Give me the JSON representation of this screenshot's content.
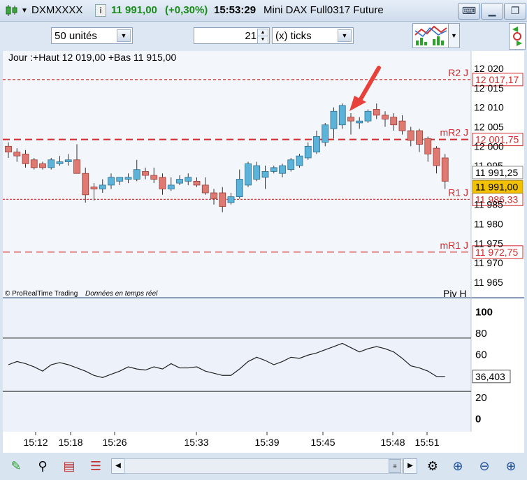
{
  "titlebar": {
    "symbol": "DXMXXXX",
    "price": "11 991,00",
    "change": "(+0,30%)",
    "time": "15:53:29",
    "name": "Mini DAX Full0317 Future"
  },
  "toolbar": {
    "units": "50 unités",
    "count": "21",
    "mode": "(x) ticks"
  },
  "price_chart": {
    "info": "Jour :+Haut 12 019,00 +Bas 11 915,00",
    "copyright": "© ProRealTime Trading",
    "realtime": "Données en temps réel",
    "piv_label": "Piv H",
    "ticks": [
      "12 020",
      "12 015",
      "12 010",
      "12 005",
      "12 000",
      "11 995",
      "11 990",
      "11 985",
      "11 980",
      "11 975",
      "11 970",
      "11 965"
    ],
    "levels": [
      {
        "name": "R2 J",
        "value": "12 017,17"
      },
      {
        "name": "mR2 J",
        "value": "12 001,75"
      },
      {
        "name": "R1 J",
        "value": "11 986,33"
      },
      {
        "name": "mR1 J",
        "value": "11 972,75"
      }
    ],
    "last_price": "11 991,00",
    "prev_price": "11 991,25"
  },
  "chart_data": {
    "type": "candlestick",
    "ylim": [
      11963,
      12022
    ],
    "candles": [
      {
        "o": 12000,
        "h": 12001,
        "l": 11997,
        "c": 11998.5
      },
      {
        "o": 11998.5,
        "h": 11999.5,
        "l": 11996,
        "c": 11997.5
      },
      {
        "o": 11998,
        "h": 11999,
        "l": 11994.5,
        "c": 11995.5
      },
      {
        "o": 11996.5,
        "h": 11997,
        "l": 11994,
        "c": 11994.5
      },
      {
        "o": 11995.5,
        "h": 11996,
        "l": 11994,
        "c": 11994.5
      },
      {
        "o": 11994.5,
        "h": 11997,
        "l": 11994,
        "c": 11996.5
      },
      {
        "o": 11995.5,
        "h": 11997.5,
        "l": 11995,
        "c": 11996
      },
      {
        "o": 11996,
        "h": 11998,
        "l": 11995,
        "c": 11996.5
      },
      {
        "o": 11996.5,
        "h": 12000.5,
        "l": 11994,
        "c": 11993
      },
      {
        "o": 11993,
        "h": 11994.5,
        "l": 11985.5,
        "c": 11987.5
      },
      {
        "o": 11989.5,
        "h": 11990.5,
        "l": 11986,
        "c": 11989
      },
      {
        "o": 11989,
        "h": 11991.5,
        "l": 11988,
        "c": 11990
      },
      {
        "o": 11990,
        "h": 11993,
        "l": 11989,
        "c": 11992
      },
      {
        "o": 11991,
        "h": 11992,
        "l": 11990,
        "c": 11992
      },
      {
        "o": 11991.5,
        "h": 11993,
        "l": 11990.5,
        "c": 11992
      },
      {
        "o": 11991.5,
        "h": 11996.5,
        "l": 11991,
        "c": 11994
      },
      {
        "o": 11993.5,
        "h": 11994.5,
        "l": 11991.5,
        "c": 11992.5
      },
      {
        "o": 11992.5,
        "h": 11994.5,
        "l": 11990.5,
        "c": 11991.5
      },
      {
        "o": 11992,
        "h": 11993,
        "l": 11987.5,
        "c": 11989
      },
      {
        "o": 11989,
        "h": 11992,
        "l": 11988.5,
        "c": 11990
      },
      {
        "o": 11990.5,
        "h": 11992.5,
        "l": 11990,
        "c": 11991.5
      },
      {
        "o": 11991,
        "h": 11993,
        "l": 11990,
        "c": 11992
      },
      {
        "o": 11991,
        "h": 11992,
        "l": 11989.5,
        "c": 11990
      },
      {
        "o": 11990,
        "h": 11992,
        "l": 11987.5,
        "c": 11988
      },
      {
        "o": 11988,
        "h": 11989,
        "l": 11985,
        "c": 11986.5
      },
      {
        "o": 11988,
        "h": 11989.5,
        "l": 11983,
        "c": 11984.5
      },
      {
        "o": 11985.5,
        "h": 11988,
        "l": 11985,
        "c": 11987
      },
      {
        "o": 11987,
        "h": 11994,
        "l": 11986.5,
        "c": 11991.5
      },
      {
        "o": 11990,
        "h": 11996,
        "l": 11989.5,
        "c": 11995.5
      },
      {
        "o": 11991.5,
        "h": 11996,
        "l": 11991,
        "c": 11995
      },
      {
        "o": 11992,
        "h": 11995,
        "l": 11989,
        "c": 11993.5
      },
      {
        "o": 11993.5,
        "h": 11995,
        "l": 11993,
        "c": 11994.5
      },
      {
        "o": 11993,
        "h": 11995.5,
        "l": 11992,
        "c": 11995
      },
      {
        "o": 11994,
        "h": 11997,
        "l": 11993.5,
        "c": 11996.5
      },
      {
        "o": 11995,
        "h": 11998,
        "l": 11994.5,
        "c": 11997.5
      },
      {
        "o": 11997,
        "h": 12001,
        "l": 11996.5,
        "c": 12000
      },
      {
        "o": 11998.5,
        "h": 12004,
        "l": 11998,
        "c": 12002.5
      },
      {
        "o": 12001,
        "h": 12006,
        "l": 12000,
        "c": 12005.5
      },
      {
        "o": 12004.5,
        "h": 12010,
        "l": 12002,
        "c": 12009
      },
      {
        "o": 12005.5,
        "h": 12011,
        "l": 12004.5,
        "c": 12010.5
      },
      {
        "o": 12007.5,
        "h": 12008.5,
        "l": 12003,
        "c": 12006.5
      },
      {
        "o": 12006,
        "h": 12007.5,
        "l": 12004.5,
        "c": 12006.5
      },
      {
        "o": 12006.5,
        "h": 12009.5,
        "l": 12006,
        "c": 12009
      },
      {
        "o": 12009.5,
        "h": 12011,
        "l": 12007,
        "c": 12008
      },
      {
        "o": 12008,
        "h": 12009,
        "l": 12005,
        "c": 12007
      },
      {
        "o": 12007.5,
        "h": 12008.5,
        "l": 12004,
        "c": 12005.5
      },
      {
        "o": 12006.5,
        "h": 12008,
        "l": 12003,
        "c": 12004
      },
      {
        "o": 12004,
        "h": 12005,
        "l": 12000,
        "c": 12001.5
      },
      {
        "o": 12004,
        "h": 12004.5,
        "l": 11998.5,
        "c": 12000.5
      },
      {
        "o": 12002,
        "h": 12002.5,
        "l": 11996,
        "c": 11998
      },
      {
        "o": 11999.5,
        "h": 12000,
        "l": 11993,
        "c": 11995
      },
      {
        "o": 11997,
        "h": 11998,
        "l": 11989,
        "c": 11991
      }
    ],
    "indicator": {
      "ylim": [
        -5,
        105
      ],
      "ticks": [
        0,
        20,
        40,
        60,
        80,
        100
      ],
      "hlines": [
        75,
        25
      ],
      "last": "36,403",
      "values": [
        50,
        53,
        51,
        48,
        44,
        50,
        52,
        50,
        47,
        44,
        40,
        38,
        41,
        44,
        48,
        46,
        45,
        48,
        46,
        51,
        47,
        47,
        48,
        44,
        42,
        40,
        40,
        46,
        53,
        57,
        54,
        50,
        53,
        57,
        56,
        59,
        61,
        64,
        67,
        70,
        66,
        62,
        65,
        67,
        65,
        62,
        56,
        49,
        47,
        44,
        39,
        39
      ]
    },
    "xticks": [
      "15:12",
      "15:18",
      "15:26",
      "15:33",
      "15:39",
      "15:45",
      "15:48",
      "15:51"
    ]
  },
  "icons": [
    "candlestick-icon",
    "info-icon",
    "keyboard-icon",
    "minimize-icon",
    "restore-icon",
    "close-icon",
    "indicators-icon"
  ]
}
